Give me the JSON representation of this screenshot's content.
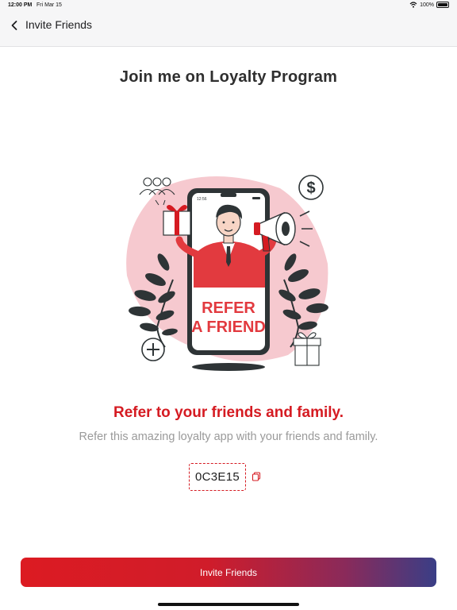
{
  "status_bar": {
    "time": "12:00 PM",
    "date": "Fri Mar 15",
    "battery": "100%"
  },
  "nav": {
    "title": "Invite Friends",
    "back_icon": "chevron-left-icon"
  },
  "page_heading": "Join me on Loyalty Program",
  "illustration": {
    "phone_time": "12:56",
    "badge_line1": "REFER",
    "badge_line2": "A FRIEND",
    "coin_symbol": "$"
  },
  "headline": "Refer to your friends and family.",
  "subtext": "Refer this amazing loyalty app with your friends and family.",
  "referral": {
    "code": "0C3E15",
    "copy_icon": "copy-icon"
  },
  "actions": {
    "invite_label": "Invite Friends"
  },
  "colors": {
    "accent_red": "#d51b22",
    "gradient_end": "#3a3e86",
    "subtext_gray": "#9a9a9a",
    "blush": "#f6c9cf"
  }
}
